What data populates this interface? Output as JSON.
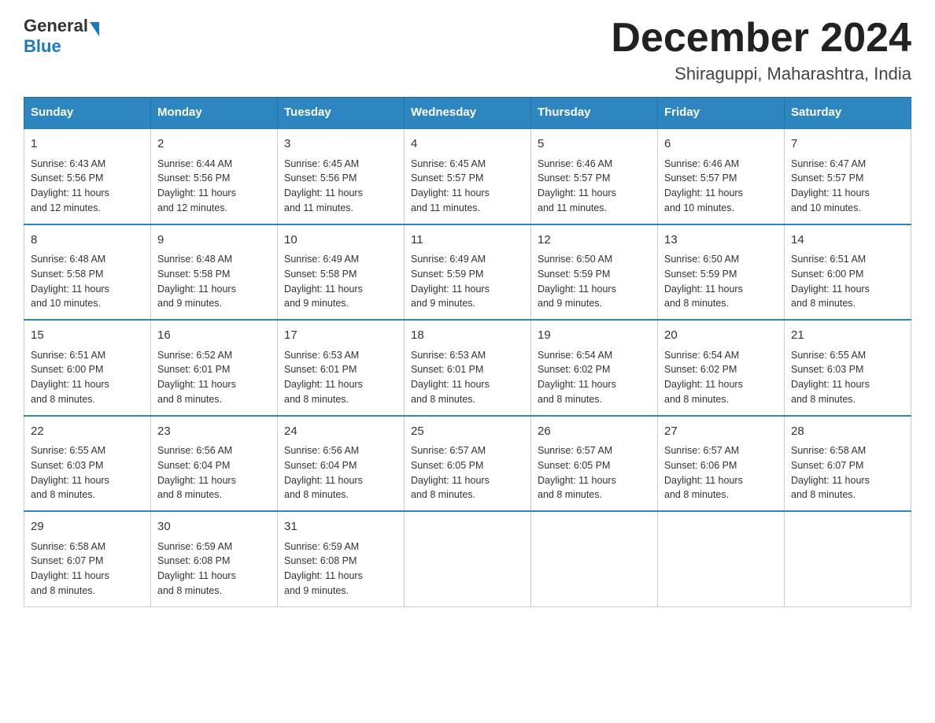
{
  "header": {
    "logo_general": "General",
    "logo_blue": "Blue",
    "month_title": "December 2024",
    "location": "Shiraguppi, Maharashtra, India"
  },
  "days_of_week": [
    "Sunday",
    "Monday",
    "Tuesday",
    "Wednesday",
    "Thursday",
    "Friday",
    "Saturday"
  ],
  "weeks": [
    [
      {
        "day": "1",
        "sunrise": "6:43 AM",
        "sunset": "5:56 PM",
        "daylight": "11 hours and 12 minutes."
      },
      {
        "day": "2",
        "sunrise": "6:44 AM",
        "sunset": "5:56 PM",
        "daylight": "11 hours and 12 minutes."
      },
      {
        "day": "3",
        "sunrise": "6:45 AM",
        "sunset": "5:56 PM",
        "daylight": "11 hours and 11 minutes."
      },
      {
        "day": "4",
        "sunrise": "6:45 AM",
        "sunset": "5:57 PM",
        "daylight": "11 hours and 11 minutes."
      },
      {
        "day": "5",
        "sunrise": "6:46 AM",
        "sunset": "5:57 PM",
        "daylight": "11 hours and 11 minutes."
      },
      {
        "day": "6",
        "sunrise": "6:46 AM",
        "sunset": "5:57 PM",
        "daylight": "11 hours and 10 minutes."
      },
      {
        "day": "7",
        "sunrise": "6:47 AM",
        "sunset": "5:57 PM",
        "daylight": "11 hours and 10 minutes."
      }
    ],
    [
      {
        "day": "8",
        "sunrise": "6:48 AM",
        "sunset": "5:58 PM",
        "daylight": "11 hours and 10 minutes."
      },
      {
        "day": "9",
        "sunrise": "6:48 AM",
        "sunset": "5:58 PM",
        "daylight": "11 hours and 9 minutes."
      },
      {
        "day": "10",
        "sunrise": "6:49 AM",
        "sunset": "5:58 PM",
        "daylight": "11 hours and 9 minutes."
      },
      {
        "day": "11",
        "sunrise": "6:49 AM",
        "sunset": "5:59 PM",
        "daylight": "11 hours and 9 minutes."
      },
      {
        "day": "12",
        "sunrise": "6:50 AM",
        "sunset": "5:59 PM",
        "daylight": "11 hours and 9 minutes."
      },
      {
        "day": "13",
        "sunrise": "6:50 AM",
        "sunset": "5:59 PM",
        "daylight": "11 hours and 8 minutes."
      },
      {
        "day": "14",
        "sunrise": "6:51 AM",
        "sunset": "6:00 PM",
        "daylight": "11 hours and 8 minutes."
      }
    ],
    [
      {
        "day": "15",
        "sunrise": "6:51 AM",
        "sunset": "6:00 PM",
        "daylight": "11 hours and 8 minutes."
      },
      {
        "day": "16",
        "sunrise": "6:52 AM",
        "sunset": "6:01 PM",
        "daylight": "11 hours and 8 minutes."
      },
      {
        "day": "17",
        "sunrise": "6:53 AM",
        "sunset": "6:01 PM",
        "daylight": "11 hours and 8 minutes."
      },
      {
        "day": "18",
        "sunrise": "6:53 AM",
        "sunset": "6:01 PM",
        "daylight": "11 hours and 8 minutes."
      },
      {
        "day": "19",
        "sunrise": "6:54 AM",
        "sunset": "6:02 PM",
        "daylight": "11 hours and 8 minutes."
      },
      {
        "day": "20",
        "sunrise": "6:54 AM",
        "sunset": "6:02 PM",
        "daylight": "11 hours and 8 minutes."
      },
      {
        "day": "21",
        "sunrise": "6:55 AM",
        "sunset": "6:03 PM",
        "daylight": "11 hours and 8 minutes."
      }
    ],
    [
      {
        "day": "22",
        "sunrise": "6:55 AM",
        "sunset": "6:03 PM",
        "daylight": "11 hours and 8 minutes."
      },
      {
        "day": "23",
        "sunrise": "6:56 AM",
        "sunset": "6:04 PM",
        "daylight": "11 hours and 8 minutes."
      },
      {
        "day": "24",
        "sunrise": "6:56 AM",
        "sunset": "6:04 PM",
        "daylight": "11 hours and 8 minutes."
      },
      {
        "day": "25",
        "sunrise": "6:57 AM",
        "sunset": "6:05 PM",
        "daylight": "11 hours and 8 minutes."
      },
      {
        "day": "26",
        "sunrise": "6:57 AM",
        "sunset": "6:05 PM",
        "daylight": "11 hours and 8 minutes."
      },
      {
        "day": "27",
        "sunrise": "6:57 AM",
        "sunset": "6:06 PM",
        "daylight": "11 hours and 8 minutes."
      },
      {
        "day": "28",
        "sunrise": "6:58 AM",
        "sunset": "6:07 PM",
        "daylight": "11 hours and 8 minutes."
      }
    ],
    [
      {
        "day": "29",
        "sunrise": "6:58 AM",
        "sunset": "6:07 PM",
        "daylight": "11 hours and 8 minutes."
      },
      {
        "day": "30",
        "sunrise": "6:59 AM",
        "sunset": "6:08 PM",
        "daylight": "11 hours and 8 minutes."
      },
      {
        "day": "31",
        "sunrise": "6:59 AM",
        "sunset": "6:08 PM",
        "daylight": "11 hours and 9 minutes."
      },
      null,
      null,
      null,
      null
    ]
  ]
}
